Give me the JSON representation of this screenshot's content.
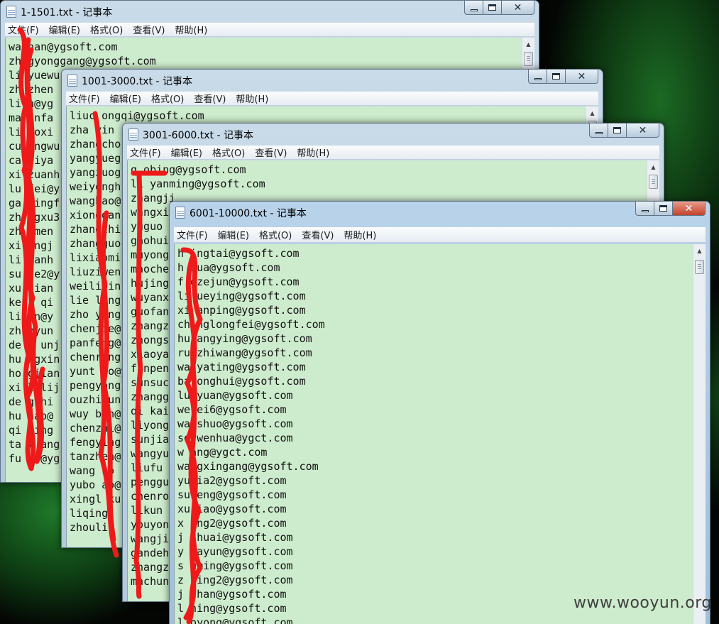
{
  "desktop": {
    "watermark": "www.wooyun.org"
  },
  "menu_labels": [
    "文件(F)",
    "编辑(E)",
    "格式(O)",
    "查看(V)",
    "帮助(H)"
  ],
  "caption_glyph_close": "✕",
  "windows": [
    {
      "title": "1-1501.txt - 记事本",
      "lines": [
        "wa han@ygsoft.com",
        "zh gyonggang@ygsoft.com",
        "li yuewu",
        "zh zhen",
        "li n@yg",
        "ma infa",
        "li aoxi",
        "cu ongwu",
        "ca aiya",
        "xi zuanh",
        "lu fei@y",
        "ga yingf",
        "zh ngxu3",
        "zh nmen",
        "xi ongj",
        "li uanh",
        "su ie2@y",
        "xu uian",
        "ke i qi",
        "li in@y",
        "zh nyun",
        "de g unj",
        "hu ngxin",
        "ho gjian",
        "xi l lij",
        "de gzhi",
        "hu hao@",
        "qi jing",
        "ta l ang",
        "fu e @yg"
      ]
    },
    {
      "title": "1001-3000.txt - 记事本",
      "lines": [
        "liuc ongqi@ygsoft.com",
        "zha yin",
        "zhangcho",
        "yangyueg",
        "yangzuog",
        "weiyongh",
        "wanghao@",
        "xionggan",
        "zhangzhi",
        "zhangguo",
        "lixiaomi",
        "liuziwen",
        "weilipin",
        "lie long",
        "zho yong",
        "chenjie@",
        "panfeng@",
        "chenrong",
        "yunt ao@y",
        "pengyong",
        "ouzhijun",
        "wuy bin@",
        "chenzhi@",
        "fengying",
        "tanzhen@",
        "wang uo",
        "yubo ao@",
        "xingl ku",
        "liqing",
        "zhouli"
      ]
    },
    {
      "title": "3001-6000.txt - 记事本",
      "lines": [
        "q obing@ygsoft.com",
        "li yanming@ygsoft.com",
        "zhangji",
        "wangxi",
        "yuguo",
        "gaohui",
        "muyong",
        "maoche",
        "hujing",
        "wuyanx",
        "guofan",
        "zhangz",
        "zhongs",
        "xiaoya",
        "fanpen",
        "sunsuc",
        "zhangg",
        "qi kai",
        "liyong",
        "sunjia",
        "wangyu",
        "liufu",
        "penggu",
        "chenro",
        "likun",
        "youyon",
        "wangji",
        "gandeh",
        "zhangz",
        "machun"
      ]
    },
    {
      "title": "6001-10000.txt - 记事本",
      "lines": [
        "h ingtai@ygsoft.com",
        "h hua@ygsoft.com",
        "f gzejun@ygsoft.com",
        "li ueying@ygsoft.com",
        "xi anping@ygsoft.com",
        "ch nglongfei@ygsoft.com",
        "hu angying@ygsoft.com",
        "ru zhiwang@ygsoft.com",
        "wa yating@ygsoft.com",
        "ba onghui@ygsoft.com",
        "lu yuan@ygsoft.com",
        "we ei6@ygsoft.com",
        "wa shuo@ygsoft.com",
        "so wenhua@ygct.com",
        "w ang@ygct.com",
        "wa gxingang@ygsoft.com",
        "yu ia2@ygsoft.com",
        "su eng@ygsoft.com",
        "xu iao@ygsoft.com",
        "x ang2@ygsoft.com",
        "j shuai@ygsoft.com",
        "y iayun@ygsoft.com",
        "s uming@ygsoft.com",
        "z ying2@ygsoft.com",
        "j chan@ygsoft.com",
        "l ning@ygsoft.com",
        "l oyong@ygsoft.com"
      ]
    }
  ]
}
